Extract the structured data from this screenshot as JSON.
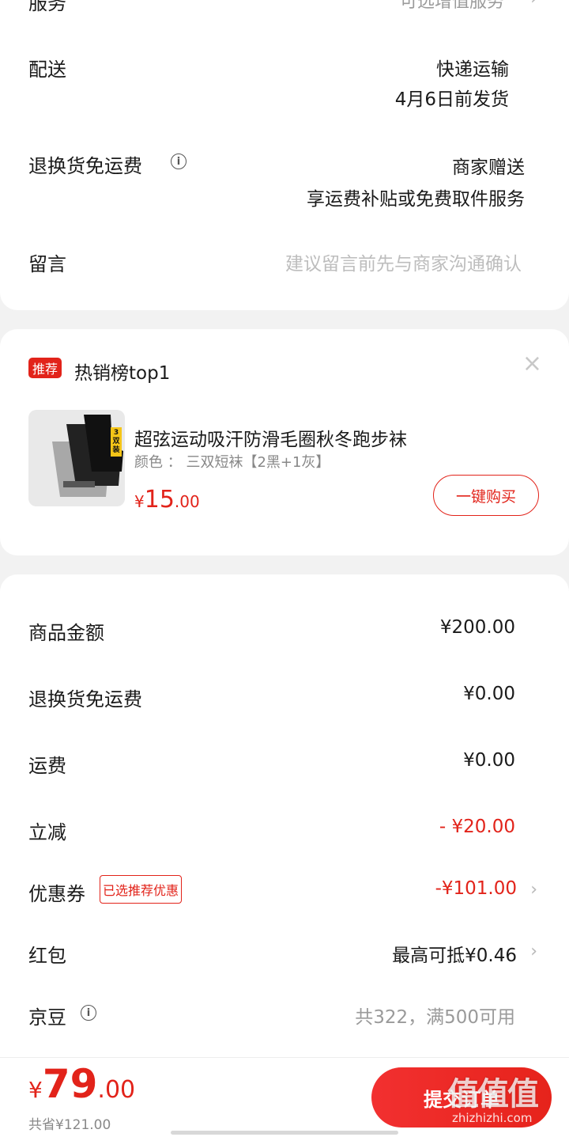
{
  "service": {
    "label": "服务",
    "value": "可选增值服务"
  },
  "delivery": {
    "label": "配送",
    "method": "快递运输",
    "ship_date": "4月6日前发货"
  },
  "return_shipping": {
    "label": "退换货免运费",
    "line1": "商家赠送",
    "line2": "享运费补贴或免费取件服务"
  },
  "message": {
    "label": "留言",
    "placeholder": "建议留言前先与商家沟通确认"
  },
  "recommend": {
    "tag": "推荐",
    "title": "热销榜top1",
    "close": "×",
    "product": {
      "image_badge": "3双装",
      "name": "超弦运动吸汗防滑毛圈秋冬跑步袜",
      "spec": "颜色 ： 三双短袜【2黑+1灰】",
      "price_symbol": "¥",
      "price_int": "15",
      "price_dec": ".00",
      "buy_button": "一键购买"
    }
  },
  "summary": {
    "goods_amount": {
      "label": "商品金额",
      "value": "¥200.00"
    },
    "return_fee": {
      "label": "退换货免运费",
      "value": "¥0.00"
    },
    "shipping": {
      "label": "运费",
      "value": "¥0.00"
    },
    "instant_discount": {
      "label": "立减",
      "value": "- ¥20.00"
    },
    "coupon": {
      "label": "优惠券",
      "badge": "已选推荐优惠",
      "value": "-¥101.00"
    },
    "red_packet": {
      "label": "红包",
      "value": "最高可抵¥0.46"
    },
    "jingdou": {
      "label": "京豆",
      "value": "共322，满500可用"
    }
  },
  "footer": {
    "price_symbol": "¥",
    "price_int": "79",
    "price_dec": ".00",
    "saved": "共省¥121.00",
    "submit_label": "提交订单"
  },
  "watermark": {
    "text": "值值值",
    "url": "zhizhizhi.com"
  },
  "colors": {
    "accent": "#e2231a",
    "button_gradient_start": "#f23030",
    "button_gradient_end": "#e6231b"
  }
}
